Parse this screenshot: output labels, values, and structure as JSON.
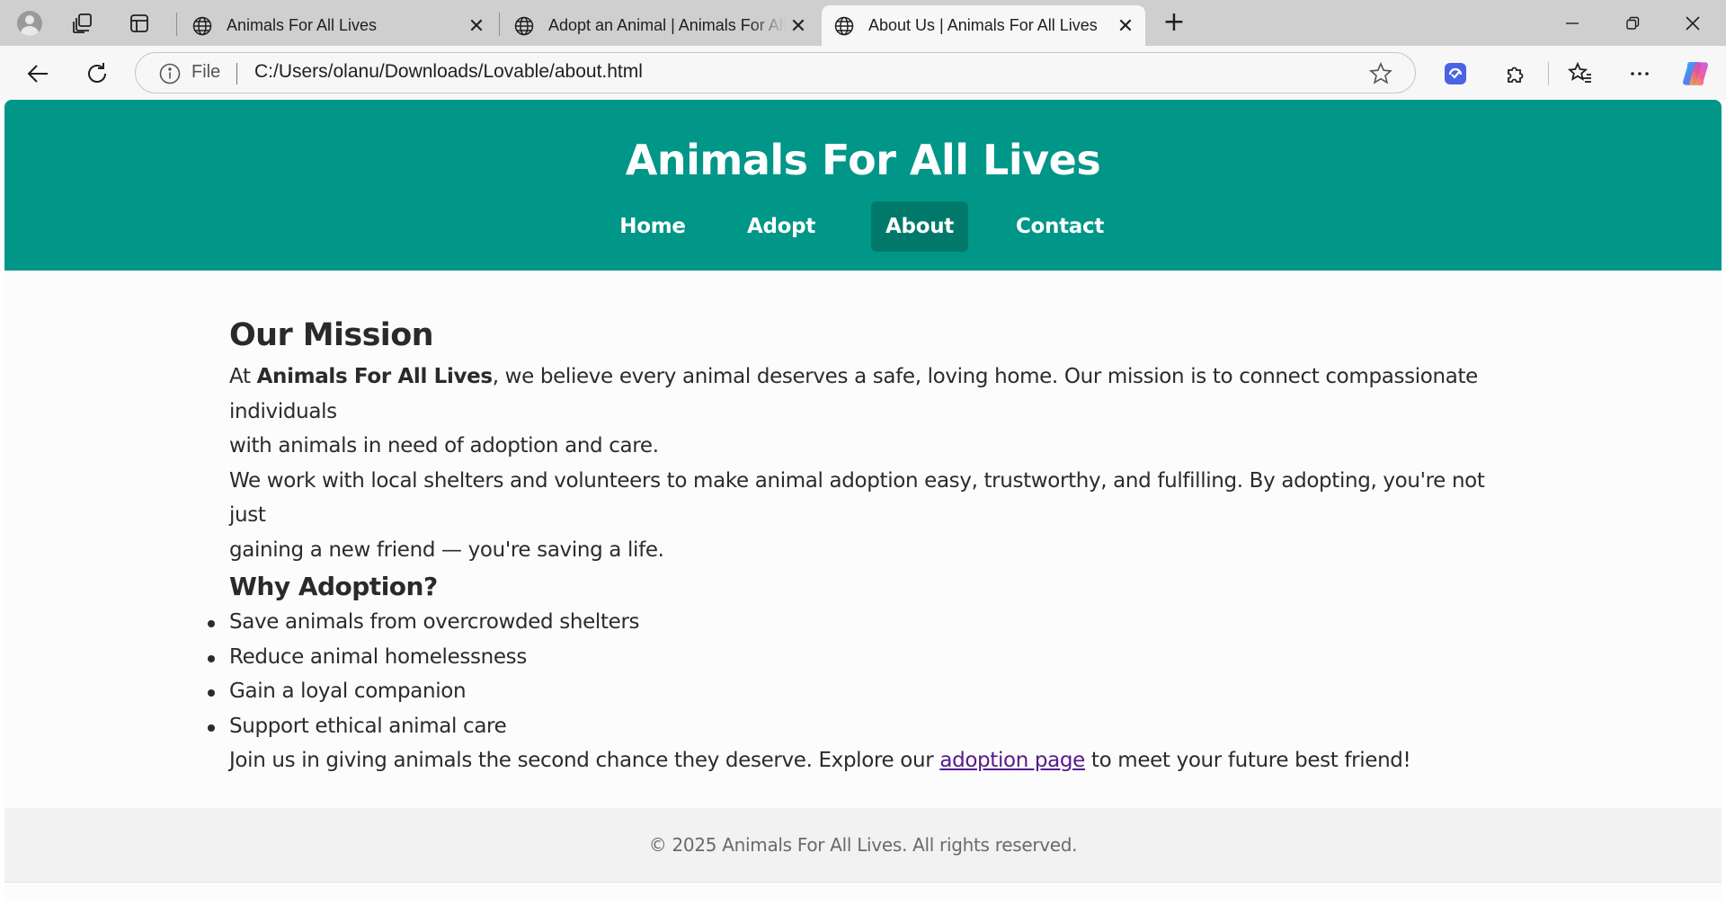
{
  "browser": {
    "tabs": [
      {
        "title": "Animals For All Lives",
        "close": "✕"
      },
      {
        "title": "Adopt an Animal | Animals For All",
        "close": "✕"
      },
      {
        "title": "About Us | Animals For All Lives",
        "close": "✕"
      }
    ],
    "new_tab": "+",
    "address": {
      "scheme_label": "File",
      "url": "C:/Users/olanu/Downloads/Lovable/about.html"
    }
  },
  "site": {
    "title": "Animals For All Lives",
    "nav": [
      {
        "label": "Home"
      },
      {
        "label": "Adopt"
      },
      {
        "label": "About",
        "active": true
      },
      {
        "label": "Contact"
      }
    ]
  },
  "content": {
    "mission_heading": "Our Mission",
    "mission_p1_pre": "At ",
    "mission_p1_brand": "Animals For All Lives",
    "mission_p1_line1_rest": ", we believe every animal deserves a safe, loving home. Our mission is to connect compassionate individuals",
    "mission_p1_line2": "with animals in need of adoption and care.",
    "mission_p2_line1": "We work with local shelters and volunteers to make animal adoption easy, trustworthy, and fulfilling. By adopting, you're not just",
    "mission_p2_line2": "gaining a new friend — you're saving a life.",
    "why_heading": "Why Adoption?",
    "reasons": [
      "Save animals from overcrowded shelters",
      "Reduce animal homelessness",
      "Gain a loyal companion",
      "Support ethical animal care"
    ],
    "closing_pre": "Join us in giving animals the second chance they deserve. Explore our ",
    "closing_link": "adoption page",
    "closing_post": " to meet your future best friend!"
  },
  "footer": {
    "text": "© 2025 Animals For All Lives. All rights reserved."
  },
  "colors": {
    "header_bg": "#009688",
    "nav_active_bg": "#00796b",
    "link_visited": "#551a8b"
  },
  "icons": [
    "profile-avatar-icon",
    "workspaces-icon",
    "vertical-tabs-icon",
    "globe-icon",
    "back-arrow-icon",
    "refresh-icon",
    "info-icon",
    "favorite-star-icon",
    "browser-essentials-icon",
    "extensions-icon",
    "favorites-icon",
    "more-icon",
    "copilot-icon",
    "minimize-icon",
    "restore-icon",
    "close-icon"
  ]
}
